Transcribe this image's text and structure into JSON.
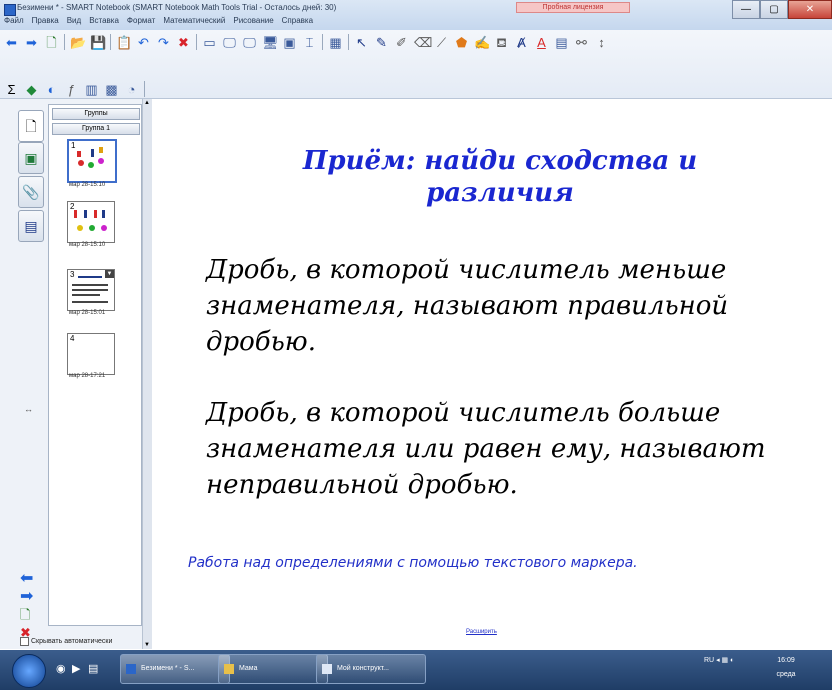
{
  "window": {
    "title": "Безимени * - SMART Notebook (SMART Notebook Math Tools Trial - Осталось дней: 30)",
    "trial_banner": "Пробная лицензия",
    "controls": [
      "—",
      "▢",
      "✕"
    ]
  },
  "menu": [
    "Файл",
    "Правка",
    "Вид",
    "Вставка",
    "Формат",
    "Математический",
    "Рисование",
    "Справка"
  ],
  "sidebar": {
    "group_button": "Группы",
    "group_name": "Группа 1",
    "pages": [
      {
        "number": "1",
        "date": "мар 28-15:10"
      },
      {
        "number": "2",
        "date": "мар 28-15:10"
      },
      {
        "number": "3",
        "date": "мар 28-15:01"
      },
      {
        "number": "4",
        "date": "мар 28-17:21"
      }
    ],
    "autohide_label": "Скрывать автоматически"
  },
  "slide": {
    "heading": "Приём: найди сходства и различия",
    "paragraph1": "Дробь, в которой числитель меньше знаменателя, называют правильной дробью.",
    "paragraph2": "Дробь, в которой числитель больше знаменателя или равен ему, называют неправильной дробью.",
    "note": "Работа над определениями с помощью текстового маркера.",
    "expand_link": "Расширить"
  },
  "taskbar": {
    "tasks": [
      "Безимени * - S...",
      "Мама",
      "Мой конструкт..."
    ],
    "language": "RU",
    "time": "16:09",
    "day": "среда"
  }
}
